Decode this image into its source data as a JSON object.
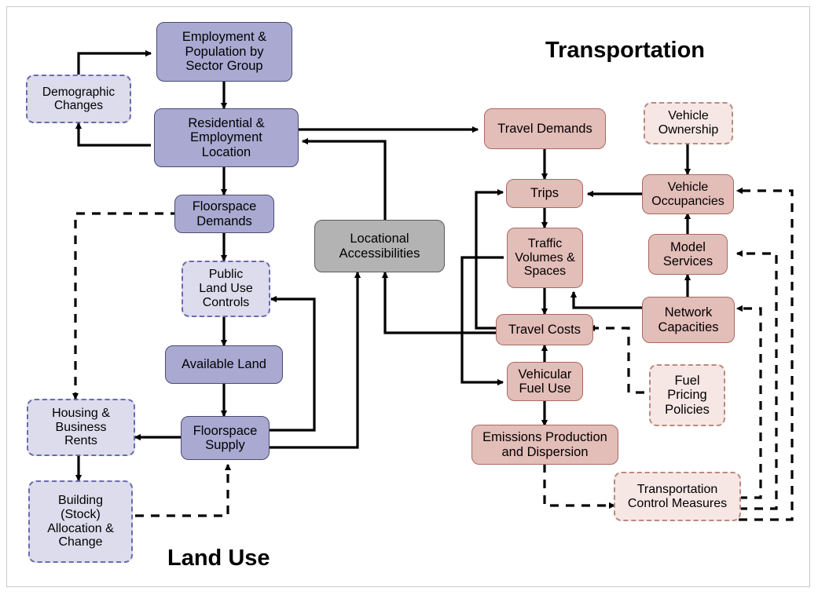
{
  "diagram": {
    "title_transportation": "Transportation",
    "title_land_use": "Land Use",
    "nodes": {
      "employment_population": "Employment &\nPopulation by\nSector Group",
      "demographic_changes": "Demographic\nChanges",
      "residential_employment": "Residential &\nEmployment\nLocation",
      "floorspace_demands": "Floorspace\nDemands",
      "public_land_use": "Public\nLand Use\nControls",
      "available_land": "Available Land",
      "floorspace_supply": "Floorspace\nSupply",
      "housing_business_rents": "Housing &\nBusiness\nRents",
      "building_stock": "Building\n(Stock)\nAllocation &\nChange",
      "locational_accessibilities": "Locational\nAccessibilities",
      "travel_demands": "Travel Demands",
      "trips": "Trips",
      "traffic_volumes": "Traffic\nVolumes &\nSpaces",
      "travel_costs": "Travel Costs",
      "vehicular_fuel_use": "Vehicular\nFuel Use",
      "emissions_production": "Emissions Production\nand Dispersion",
      "vehicle_ownership": "Vehicle\nOwnership",
      "vehicle_occupancies": "Vehicle\nOccupancies",
      "model_services": "Model\nServices",
      "network_capacities": "Network\nCapacities",
      "fuel_pricing_policies": "Fuel\nPricing\nPolicies",
      "transportation_control": "Transportation\nControl Measures"
    },
    "colors": {
      "purple_fill": "#a9a9d2",
      "purple_stroke": "#4a4a72",
      "light_blue_fill": "#dcdcec",
      "light_blue_stroke": "#6a6ab0",
      "rose_fill": "#e3bdb8",
      "rose_stroke": "#a86a63",
      "light_rose_fill": "#f6e7e4",
      "light_rose_stroke": "#b98a80",
      "grey_fill": "#b3b3b3",
      "grey_stroke": "#5a5a5a",
      "line": "#000000",
      "frame": "#c9c9c9"
    }
  }
}
